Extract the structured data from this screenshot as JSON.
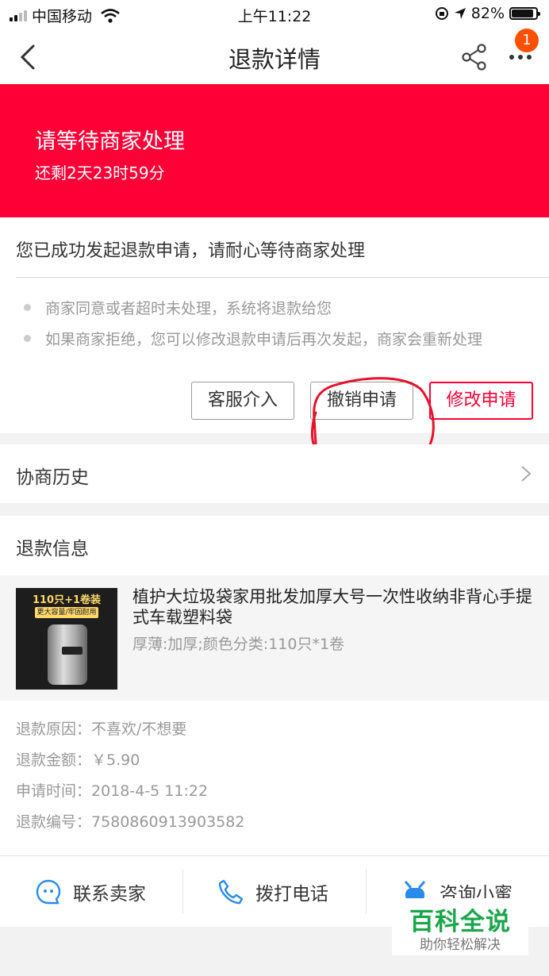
{
  "status_bar": {
    "carrier": "中国移动",
    "time": "上午11:22",
    "battery": "82%"
  },
  "nav": {
    "title": "退款详情",
    "badge_count": "1"
  },
  "hero": {
    "title": "请等待商家处理",
    "countdown": "还剩2天23时59分",
    "bg_color": "#ff0036"
  },
  "notice": {
    "message": "您已成功发起退款申请，请耐心等待商家处理",
    "tips": [
      "商家同意或者超时未处理，系统将退款给您",
      "如果商家拒绝，您可以修改退款申请后再次发起，商家会重新处理"
    ]
  },
  "actions": {
    "service": "客服介入",
    "cancel": "撤销申请",
    "modify": "修改申请"
  },
  "history": {
    "label": "协商历史"
  },
  "refund_info": {
    "title": "退款信息",
    "product": {
      "name": "植护大垃圾袋家用批发加厚大号一次性收纳非背心手提式车载塑料袋",
      "spec": "厚薄:加厚;颜色分类:110只*1卷",
      "thumb_text": "110只+1卷装",
      "thumb_tag": "更大容量/牢固耐用"
    },
    "rows": [
      {
        "label": "退款原因：",
        "value": "不喜欢/不想要"
      },
      {
        "label": "退款金额：",
        "value": "￥5.90"
      },
      {
        "label": "申请时间：",
        "value": "2018-4-5 11:22"
      },
      {
        "label": "退款编号：",
        "value": "7580860913903582"
      }
    ]
  },
  "bottom_bar": {
    "contact_seller": "联系卖家",
    "call": "拨打电话",
    "consult": "咨询小蜜"
  },
  "watermark": {
    "main": "百科全说",
    "sub": "助你轻松解决"
  }
}
